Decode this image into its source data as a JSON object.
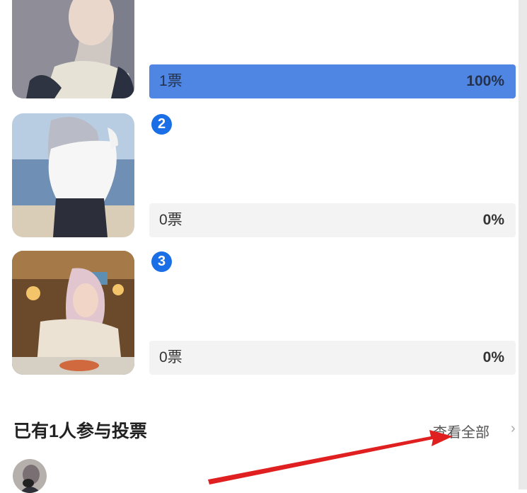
{
  "options": [
    {
      "image": "photo-girl-gray-hair-sweater",
      "votes_label": "1票",
      "percent_label": "100%",
      "share": 1.0,
      "active": true
    },
    {
      "number": "2",
      "image": "photo-girl-beach-back-view",
      "votes_label": "0票",
      "percent_label": "0%",
      "share": 0.0,
      "active": false
    },
    {
      "number": "3",
      "image": "photo-girl-restaurant-pink-hair",
      "votes_label": "0票",
      "percent_label": "0%",
      "share": 0.0,
      "active": false
    }
  ],
  "footer": {
    "participants_title": "已有1人参与投票",
    "view_all_label": "查看全部",
    "chevron": "›"
  },
  "colors": {
    "accent": "#4f86e4",
    "badge": "#1b6fe6",
    "annotation_arrow": "#e02020"
  }
}
